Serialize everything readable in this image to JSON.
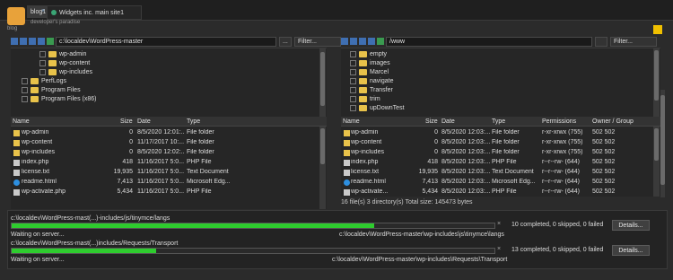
{
  "tabs": [
    {
      "label": "blog1",
      "close": "×"
    },
    {
      "label": "Widgets inc. main site1"
    }
  ],
  "subtitle": "developer's paradise",
  "subtitle_left": "blog",
  "left": {
    "path": "c:\\localdev\\WordPress-master",
    "filter": "Filter...",
    "more": "...",
    "tree": [
      "wp-admin",
      "wp-content",
      "wp-includes",
      "PerfLogs",
      "Program Files",
      "Program Files (x86)"
    ],
    "columns": [
      "Name",
      "Size",
      "Date",
      "Type"
    ],
    "files": [
      {
        "name": "wp-admin",
        "size": "0",
        "date": "8/5/2020 12:01:...",
        "type": "File folder",
        "icon": "folder"
      },
      {
        "name": "wp-content",
        "size": "0",
        "date": "11/17/2017 10:...",
        "type": "File folder",
        "icon": "folder"
      },
      {
        "name": "wp-includes",
        "size": "0",
        "date": "8/5/2020 12:02:...",
        "type": "File folder",
        "icon": "folder"
      },
      {
        "name": "index.php",
        "size": "418",
        "date": "11/16/2017 5:0...",
        "type": "PHP File",
        "icon": "file"
      },
      {
        "name": "license.txt",
        "size": "19,935",
        "date": "11/16/2017 5:0...",
        "type": "Text Document",
        "icon": "file"
      },
      {
        "name": "readme.html",
        "size": "7,413",
        "date": "11/16/2017 5:0...",
        "type": "Microsoft Edg...",
        "icon": "edge"
      },
      {
        "name": "wp-activate.php",
        "size": "5,434",
        "date": "11/16/2017 5:0...",
        "type": "PHP File",
        "icon": "file"
      }
    ]
  },
  "right": {
    "path": "/www",
    "filter": "Filter...",
    "tree": [
      "empty",
      "images",
      "Marcel",
      "navigate",
      "Transfer",
      "trim",
      "upDownTest"
    ],
    "columns": [
      "Name",
      "Size",
      "Date",
      "Type",
      "Permissions",
      "Owner / Group"
    ],
    "files": [
      {
        "name": "wp-admin",
        "size": "0",
        "date": "8/5/2020 12:03:...",
        "type": "File folder",
        "perm": "r-xr-xrwx (755)",
        "owner": "502 502",
        "icon": "folder"
      },
      {
        "name": "wp-content",
        "size": "0",
        "date": "8/5/2020 12:03:...",
        "type": "File folder",
        "perm": "r-xr-xrwx (755)",
        "owner": "502 502",
        "icon": "folder"
      },
      {
        "name": "wp-includes",
        "size": "0",
        "date": "8/5/2020 12:03:...",
        "type": "File folder",
        "perm": "r-xr-xrwx (755)",
        "owner": "502 502",
        "icon": "folder"
      },
      {
        "name": "index.php",
        "size": "418",
        "date": "8/5/2020 12:03:...",
        "type": "PHP File",
        "perm": "r--r--rw- (644)",
        "owner": "502 502",
        "icon": "file"
      },
      {
        "name": "license.txt",
        "size": "19,935",
        "date": "8/5/2020 12:03:...",
        "type": "Text Document",
        "perm": "r--r--rw- (644)",
        "owner": "502 502",
        "icon": "file"
      },
      {
        "name": "readme.html",
        "size": "7,413",
        "date": "8/5/2020 12:03:...",
        "type": "Microsoft Edg...",
        "perm": "r--r--rw- (644)",
        "owner": "502 502",
        "icon": "edge"
      },
      {
        "name": "wp-activate...",
        "size": "5,434",
        "date": "8/5/2020 12:03:...",
        "type": "PHP File",
        "perm": "r--r--rw- (644)",
        "owner": "502 502",
        "icon": "file"
      }
    ],
    "status": "16 file(s)  3 directory(s) Total size: 145473 bytes"
  },
  "queue": [
    {
      "path": "c:\\localdev\\WordPress-mast(...)-includes/js/tinymce/langs",
      "progress": 0.75,
      "remote": "c:\\localdev\\WordPress-master\\wp-includes\\js\\tinymce\\langs",
      "summary": "10 completed, 0 skipped, 0 failed",
      "status": "Waiting on server...",
      "details": "Details...",
      "close": "×"
    },
    {
      "path": "c:\\localdev\\WordPress-mast(...)includes/Requests/Transport",
      "progress": 0.3,
      "remote": "c:\\localdev\\WordPress-master\\wp-includes\\Requests\\Transport",
      "summary": "13 completed, 0 skipped, 0 failed",
      "status": "Waiting on server...",
      "details": "Details...",
      "close": "×"
    }
  ],
  "colors": {
    "accent": "#2ecc2e",
    "folder": "#e8c24a",
    "nav": "#3f6fb2"
  }
}
